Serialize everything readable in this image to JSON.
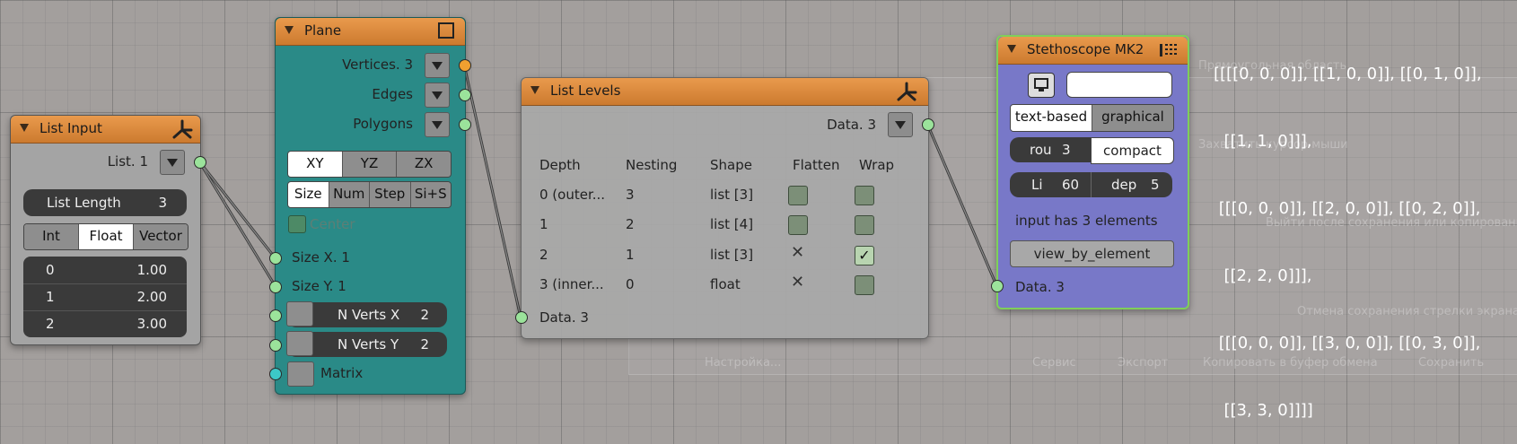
{
  "background_ghost": {
    "labels": [
      "Прямоугольная область",
      "Захватить курсор мыши",
      "Выйти после сохранения или копирования",
      "Отмена сохранения стрелки экрана",
      "Настройка...",
      "Сервис",
      "Экспорт",
      "Копировать в буфер обмена",
      "Сохранить"
    ]
  },
  "list_input": {
    "title": "List Input",
    "output_label": "List. 1",
    "length_label": "List Length",
    "length_value": "3",
    "mode_buttons": [
      "Int",
      "Float",
      "Vector"
    ],
    "selected_mode": "Float",
    "rows": [
      {
        "index": "0",
        "value": "1.00"
      },
      {
        "index": "1",
        "value": "2.00"
      },
      {
        "index": "2",
        "value": "3.00"
      }
    ]
  },
  "plane": {
    "title": "Plane",
    "outputs": [
      "Vertices. 3",
      "Edges",
      "Polygons"
    ],
    "axis_buttons": [
      "XY",
      "YZ",
      "ZX"
    ],
    "selected_axis": "XY",
    "mode_buttons": [
      "Size",
      "Num",
      "Step",
      "Si+S"
    ],
    "selected_mode": "Size",
    "center_label": "Center",
    "inputs": [
      "Size X. 1",
      "Size Y. 1"
    ],
    "nverts_x_label": "N Verts X",
    "nverts_x_value": "2",
    "nverts_y_label": "N Verts Y",
    "nverts_y_value": "2",
    "matrix_label": "Matrix"
  },
  "list_levels": {
    "title": "List Levels",
    "output_label": "Data. 3",
    "headers": [
      "Depth",
      "Nesting",
      "Shape",
      "Flatten",
      "Wrap"
    ],
    "rows": [
      {
        "depth": "0 (outer...",
        "nesting": "3",
        "shape": "list [3]",
        "flatten": "box",
        "wrap": "box"
      },
      {
        "depth": "1",
        "nesting": "2",
        "shape": "list [4]",
        "flatten": "box",
        "wrap": "box"
      },
      {
        "depth": "2",
        "nesting": "1",
        "shape": "list [3]",
        "flatten": "x",
        "wrap": "checked"
      },
      {
        "depth": "3 (inner...",
        "nesting": "0",
        "shape": "float",
        "flatten": "x",
        "wrap": "box"
      }
    ],
    "input_label": "Data. 3"
  },
  "stethoscope": {
    "title": "Stethoscope MK2",
    "text_field_value": "",
    "view_buttons": [
      "text-based",
      "graphical"
    ],
    "selected_view": "text-based",
    "rou_label": "rou",
    "rou_value": "3",
    "compact_label": "compact",
    "li_label": "Li",
    "li_value": "60",
    "dep_label": "dep",
    "dep_value": "5",
    "info_text": "input has 3 elements",
    "view_by_element_label": "view_by_element",
    "input_label": "Data. 3"
  },
  "output_text_lines": [
    "[[[[0, 0, 0]], [[1, 0, 0]], [[0, 1, 0]],",
    "  [[1, 1, 0]]],",
    " [[[0, 0, 0]], [[2, 0, 0]], [[0, 2, 0]],",
    "  [[2, 2, 0]]],",
    " [[[0, 0, 0]], [[3, 0, 0]], [[0, 3, 0]],",
    "  [[3, 3, 0]]]]"
  ],
  "colors": {
    "header_orange": "#d98a3e",
    "plane_body": "#2a8a87",
    "stethoscope_body": "#7878c8",
    "node_gray": "#9a9a9a"
  }
}
